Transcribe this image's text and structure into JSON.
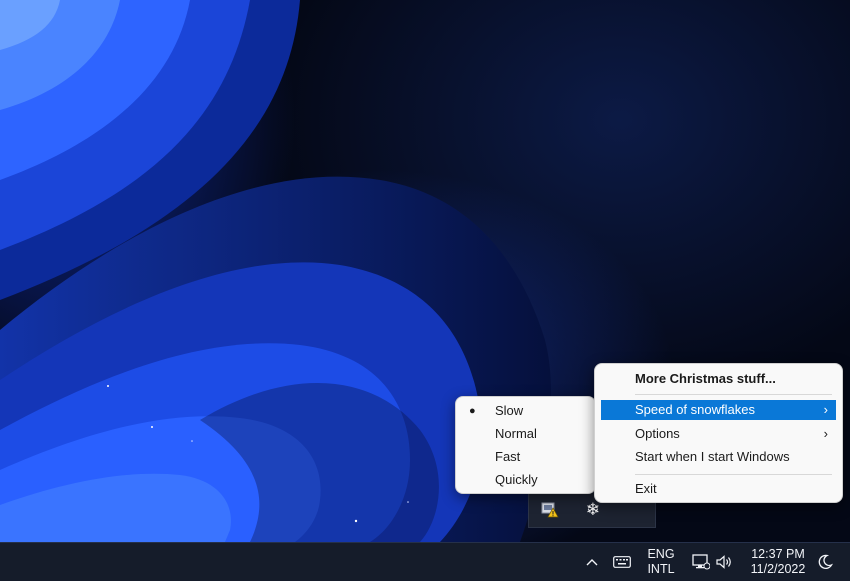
{
  "main_menu": {
    "items": [
      {
        "label": "More Christmas stuff...",
        "bold": true
      },
      {
        "label": "Speed of snowflakes",
        "highlighted": true,
        "has_submenu": true
      },
      {
        "label": "Options",
        "has_submenu": true
      },
      {
        "label": "Start when I start Windows"
      },
      {
        "label": "Exit"
      }
    ],
    "arrow": "›"
  },
  "speed_submenu": {
    "items": [
      "Slow",
      "Normal",
      "Fast",
      "Quickly"
    ],
    "selected": "Slow",
    "bullet": "●"
  },
  "tray_flyout": {
    "icons": [
      "app-warning-icon",
      "snowflake-icon"
    ],
    "snowflake_glyph": "❄"
  },
  "taskbar": {
    "chevron": "^",
    "language": {
      "line1": "ENG",
      "line2": "INTL"
    },
    "time": "12:37 PM",
    "date": "11/2/2022",
    "icons": [
      "chevron-up-icon",
      "keyboard-icon",
      "network-icon",
      "volume-icon",
      "moon-icon"
    ]
  },
  "colors": {
    "menu_highlight": "#0a78d7",
    "menu_background": "#f9f9f9",
    "taskbar_background": "#151c2a"
  }
}
